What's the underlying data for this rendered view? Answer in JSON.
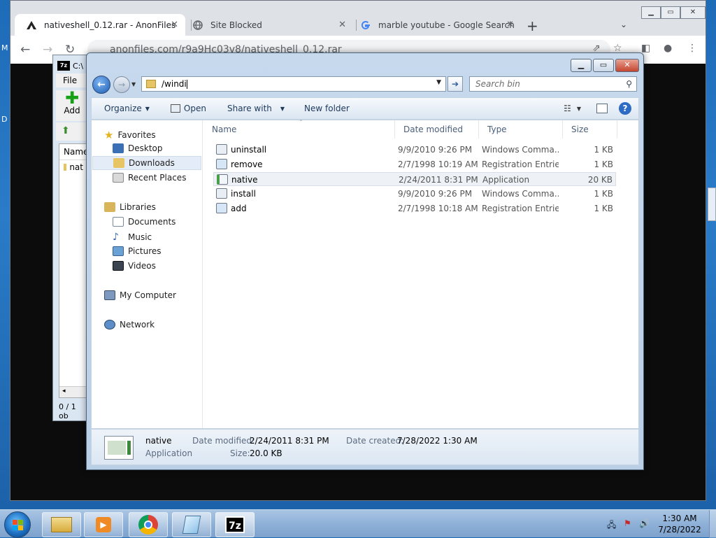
{
  "browser": {
    "tabs": [
      {
        "label": "nativeshell_0.12.rar - AnonFiles",
        "icon": "anonfiles-icon"
      },
      {
        "label": "Site Blocked",
        "icon": "globe-icon"
      },
      {
        "label": "marble youtube - Google Search",
        "icon": "google-icon"
      }
    ],
    "url": "anonfiles.com/r9a9Hc03v8/nativeshell_0.12.rar"
  },
  "sevenzip": {
    "title": "C:\\",
    "menu_file": "File",
    "add_label": "Add",
    "col_name": "Name",
    "item_name": "nat",
    "status": "0 / 1 ob"
  },
  "explorer": {
    "address": "/windi",
    "search_placeholder": "Search bin",
    "commands": {
      "organize": "Organize",
      "open": "Open",
      "share_with": "Share with",
      "new_folder": "New folder"
    },
    "nav": {
      "favorites": "Favorites",
      "desktop": "Desktop",
      "downloads": "Downloads",
      "recent_places": "Recent Places",
      "libraries": "Libraries",
      "documents": "Documents",
      "music": "Music",
      "pictures": "Pictures",
      "videos": "Videos",
      "my_computer": "My Computer",
      "network": "Network"
    },
    "columns": {
      "name": "Name",
      "date_modified": "Date modified",
      "type": "Type",
      "size": "Size"
    },
    "files": [
      {
        "name": "uninstall",
        "date": "9/9/2010 9:26 PM",
        "type": "Windows Comma...",
        "size": "1 KB",
        "icon": "cmd-script-icon"
      },
      {
        "name": "remove",
        "date": "2/7/1998 10:19 AM",
        "type": "Registration Entries",
        "size": "1 KB",
        "icon": "registry-icon"
      },
      {
        "name": "native",
        "date": "2/24/2011 8:31 PM",
        "type": "Application",
        "size": "20 KB",
        "icon": "application-icon"
      },
      {
        "name": "install",
        "date": "9/9/2010 9:26 PM",
        "type": "Windows Comma...",
        "size": "1 KB",
        "icon": "cmd-script-icon"
      },
      {
        "name": "add",
        "date": "2/7/1998 10:18 AM",
        "type": "Registration Entries",
        "size": "1 KB",
        "icon": "registry-icon"
      }
    ],
    "details": {
      "name": "native",
      "kind": "Application",
      "modified_label": "Date modified:",
      "modified_value": "2/24/2011 8:31 PM",
      "size_label": "Size:",
      "size_value": "20.0 KB",
      "created_label": "Date created:",
      "created_value": "7/28/2022 1:30 AM"
    }
  },
  "taskbar": {
    "apps": [
      "explorer-icon",
      "media-player-icon",
      "chrome-icon",
      "notepad-icon",
      "7zip-icon"
    ],
    "sevenzip_badge": "7z",
    "time": "1:30 AM",
    "date": "7/28/2022"
  },
  "colors": {
    "desktop": "#1e6bb8",
    "chrome_frame": "#dee1e6",
    "explorer_frame": "#c7d9ed",
    "taskbar": "#8fb1d8"
  }
}
